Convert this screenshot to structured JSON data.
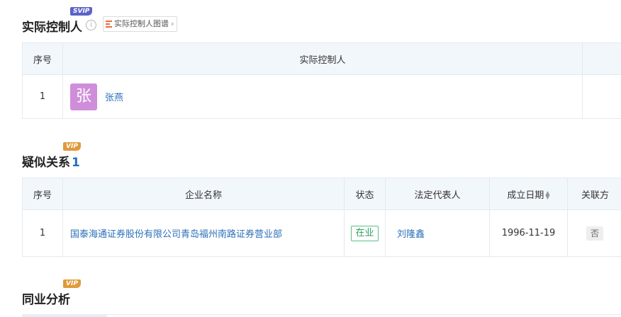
{
  "controller_section": {
    "title": "实际控制人",
    "badge": "SVIP",
    "info_icon": "info-circle-icon",
    "graph_button": {
      "label": "实际控制人图谱",
      "icon": "graph-icon"
    },
    "table": {
      "headers": [
        "序号",
        "实际控制人"
      ],
      "rows": [
        {
          "index": "1",
          "avatar_char": "张",
          "name": "张燕"
        }
      ]
    }
  },
  "related_section": {
    "title": "疑似关系",
    "count": "1",
    "badge": "VIP",
    "table": {
      "headers": [
        "序号",
        "企业名称",
        "状态",
        "法定代表人",
        "成立日期",
        "关联方"
      ],
      "rows": [
        {
          "index": "1",
          "company": "国泰海通证券股份有限公司青岛福州南路证券营业部",
          "status": "在业",
          "legal_rep": "刘隆鑫",
          "founded": "1996-11-19",
          "related": "否"
        }
      ]
    }
  },
  "industry_section": {
    "title": "同业分析",
    "badge": "VIP"
  },
  "colors": {
    "link": "#2a6fb9",
    "header_bg": "#f2f7fc",
    "svip_badge": "#5a63c8",
    "vip_badge": "#e09a3a",
    "avatar_bg": "#cf8ed9",
    "status_green": "#2e9e5e"
  }
}
